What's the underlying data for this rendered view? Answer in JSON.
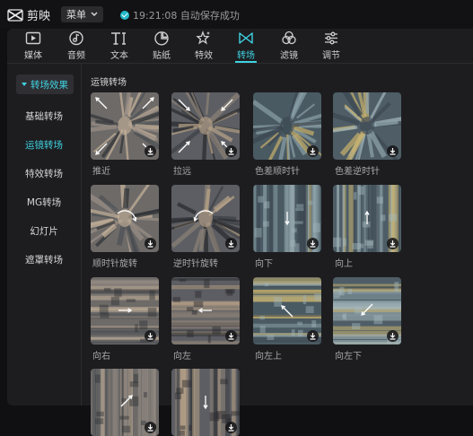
{
  "app": {
    "name": "剪映",
    "menu_label": "菜单",
    "save_status": "19:21:08 自动保存成功"
  },
  "toolbar": [
    {
      "label": "媒体",
      "icon": "media-icon"
    },
    {
      "label": "音频",
      "icon": "audio-icon"
    },
    {
      "label": "文本",
      "icon": "text-icon"
    },
    {
      "label": "贴纸",
      "icon": "sticker-icon"
    },
    {
      "label": "特效",
      "icon": "effects-icon"
    },
    {
      "label": "转场",
      "icon": "transition-icon",
      "active": true
    },
    {
      "label": "滤镜",
      "icon": "filter-icon"
    },
    {
      "label": "调节",
      "icon": "adjust-icon"
    }
  ],
  "sidebar": {
    "header": "转场效果",
    "items": [
      "基础转场",
      "运镜转场",
      "特效转场",
      "MG转场",
      "幻灯片",
      "遮罩转场"
    ],
    "active_index": 1
  },
  "section": {
    "title": "运镜转场"
  },
  "tiles": [
    {
      "label": "推近",
      "arrow": "zoom-in"
    },
    {
      "label": "拉远",
      "arrow": "zoom-out"
    },
    {
      "label": "色差顺时针",
      "arrow": "none"
    },
    {
      "label": "色差逆时针",
      "arrow": "none"
    },
    {
      "label": "顺时针旋转",
      "arrow": "rotate-cw"
    },
    {
      "label": "逆时针旋转",
      "arrow": "rotate-ccw"
    },
    {
      "label": "向下",
      "arrow": "down"
    },
    {
      "label": "向上",
      "arrow": "up"
    },
    {
      "label": "向右",
      "arrow": "right"
    },
    {
      "label": "向左",
      "arrow": "left"
    },
    {
      "label": "向左上",
      "arrow": "up-left"
    },
    {
      "label": "向左下",
      "arrow": "down-left"
    },
    {
      "label": "",
      "arrow": "up-right"
    },
    {
      "label": "",
      "arrow": "down"
    }
  ]
}
